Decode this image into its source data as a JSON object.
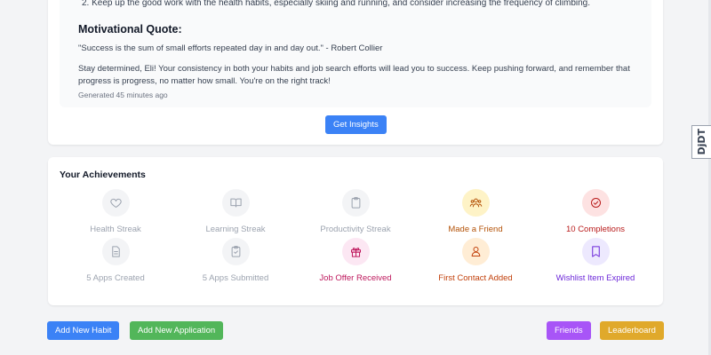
{
  "insights": {
    "clipped_line": "2.  Keep up the good work with the health habits, especially skiing and running, and consider increasing the frequency of climbing.",
    "quote_heading": "Motivational Quote:",
    "quote": "\"Success is the sum of small efforts repeated day in and day out.\" - Robert Collier",
    "motivation": "Stay determined, Eli! Your consistency in both your habits and job search efforts will lead you to success. Keep pushing forward, and remember that progress is progress, no matter how small. You're on the right track!",
    "generated": "Generated 45 minutes ago",
    "button_label": "Get Insights"
  },
  "achievements": {
    "title": "Your Achievements",
    "items": [
      {
        "label": "Health Streak",
        "icon": "heart-icon",
        "color": "#9ca3af",
        "bg": "#f3f4f6",
        "earned": false
      },
      {
        "label": "Learning Streak",
        "icon": "book-icon",
        "color": "#9ca3af",
        "bg": "#f3f4f6",
        "earned": false
      },
      {
        "label": "Productivity Streak",
        "icon": "clipboard-icon",
        "color": "#9ca3af",
        "bg": "#f3f4f6",
        "earned": false
      },
      {
        "label": "Made a Friend",
        "icon": "users-icon",
        "color": "#b45309",
        "bg": "#fef3c7",
        "earned": true
      },
      {
        "label": "10 Completions",
        "icon": "check-circle-icon",
        "color": "#b91c1c",
        "bg": "#fde2e2",
        "earned": true
      },
      {
        "label": "5 Apps Created",
        "icon": "document-icon",
        "color": "#9ca3af",
        "bg": "#f3f4f6",
        "earned": false
      },
      {
        "label": "5 Apps Submitted",
        "icon": "clipboard-check-icon",
        "color": "#9ca3af",
        "bg": "#f3f4f6",
        "earned": false
      },
      {
        "label": "Job Offer Received",
        "icon": "gift-icon",
        "color": "#be185d",
        "bg": "#fce7f3",
        "earned": true
      },
      {
        "label": "First Contact Added",
        "icon": "user-icon",
        "color": "#c2410c",
        "bg": "#ffedd5",
        "earned": true
      },
      {
        "label": "Wishlist Item Expired",
        "icon": "bookmark-icon",
        "color": "#6d28d9",
        "bg": "#ede9fe",
        "earned": true
      }
    ]
  },
  "footer": {
    "add_habit": "Add New Habit",
    "add_application": "Add New Application",
    "friends": "Friends",
    "leaderboard": "Leaderboard"
  },
  "debug_toolbar": {
    "label": "DjDT"
  }
}
